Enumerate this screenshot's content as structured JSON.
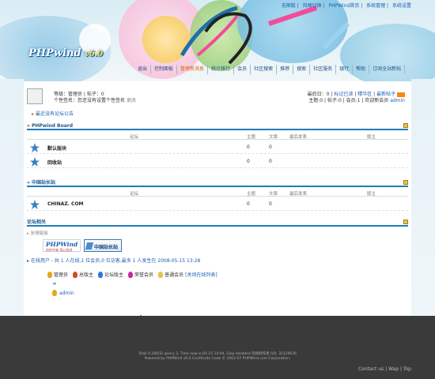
{
  "top_links": [
    "无图版",
    "风格切换",
    "PHPWind首页",
    "系统管理",
    "系统设置"
  ],
  "logo": {
    "main": "PHPwind",
    "version": "v6.0"
  },
  "nav": [
    "退出",
    "控制面板",
    "管理新消息",
    "统计排行",
    "会员",
    "社区搜索",
    "推荐",
    "搜索",
    "社区服务",
    "银行",
    "帮助",
    "订阅全站新帖"
  ],
  "nav_active_index": 2,
  "user": {
    "line1": "等级：管理员 | 帖子：0",
    "line2": "个性签名：",
    "sig_text": "您还没有设置个性签名",
    "sig_edit": "更改"
  },
  "user_right": {
    "line1_pre": "最后日：0",
    "line1_links": [
      "标记已读",
      "精华区",
      "最新帖子"
    ],
    "line2": "主题:0 | 帖子:0 | 会员:1 | 欢迎新会员 ",
    "new_member": "admin"
  },
  "notice": "最近没有论坛公告",
  "sections": [
    {
      "title": "» PHPwind Board",
      "columns": [
        "论坛",
        "主题",
        "文章",
        "最后发表",
        "版主"
      ],
      "forums": [
        {
          "name": "默认版块",
          "topics": "0",
          "posts": "0"
        },
        {
          "name": "回收站",
          "topics": "0",
          "posts": "0"
        }
      ]
    },
    {
      "title": "» 中国站长站",
      "columns": [
        "论坛",
        "主题",
        "文章",
        "最后发表",
        "版主"
      ],
      "forums": [
        {
          "name": "CHINAZ. COM",
          "topics": "0",
          "posts": "0"
        }
      ]
    }
  ],
  "links": {
    "title": "论坛相关",
    "sub": "友情链接",
    "logo1_title": "PHPWind",
    "logo1_sub": "创作中来 用心改进",
    "logo2_title": "中国站长站"
  },
  "online": "在线用户 - 共 1 人在线,1 位会员,0 位访客,最多 1 人发生在 2008-05-15 13:28",
  "legend": [
    {
      "label": "管理员",
      "color": "#e2a81a"
    },
    {
      "label": "总版主",
      "color": "#d24a2a"
    },
    {
      "label": "论坛版主",
      "color": "#2a7ad2"
    },
    {
      "label": "荣誉会员",
      "color": "#c62aa0"
    },
    {
      "label": "普通会员",
      "color": "#e8c24a"
    }
  ],
  "close_online": "[关闭在线列表]",
  "online_user": "admin",
  "footer": {
    "line1": "Total 0.296(S) query 3, Time now is:05-15 14:04, Gzip disabled 风格制作者 QQ: 32119636",
    "line2": "Powered by PHPWind v6.0 Certificate Code © 2003-07 PHPWind.com Corporation.",
    "links": "Contact us | Wap | Top"
  }
}
